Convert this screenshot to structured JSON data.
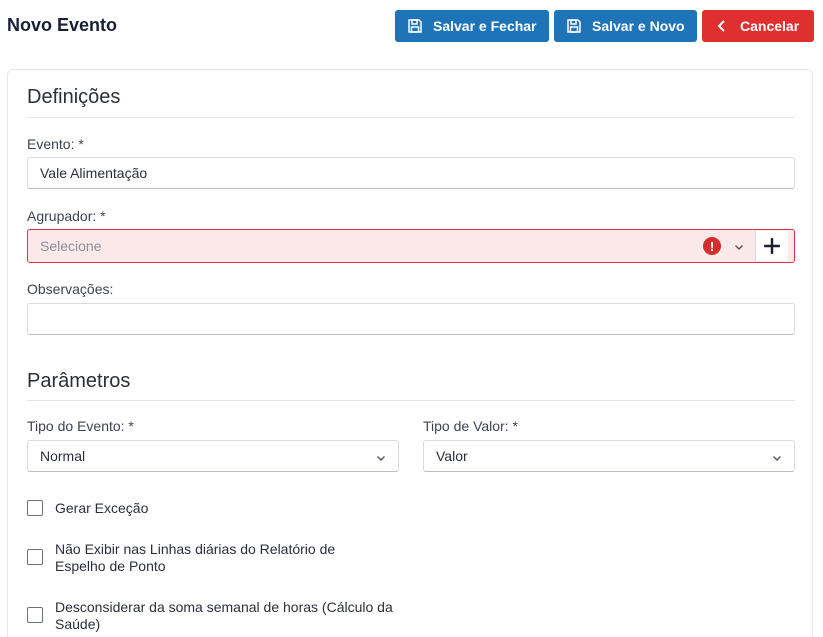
{
  "page_title": "Novo Evento",
  "toolbar": {
    "save_close_label": "Salvar e Fechar",
    "save_new_label": "Salvar e Novo",
    "cancel_label": "Cancelar"
  },
  "definicoes": {
    "title": "Definições",
    "evento_label": "Evento: *",
    "evento_value": "Vale Alimentação",
    "agrupador_label": "Agrupador: *",
    "agrupador_placeholder": "Selecione",
    "observacoes_label": "Observações:",
    "observacoes_value": ""
  },
  "parametros": {
    "title": "Parâmetros",
    "tipo_evento_label": "Tipo do Evento: *",
    "tipo_evento_value": "Normal",
    "tipo_valor_label": "Tipo de Valor: *",
    "tipo_valor_value": "Valor",
    "checkboxes": [
      {
        "label": "Gerar Exceção",
        "checked": false
      },
      {
        "label": "Não Exibir nas Linhas diárias do Relatório de Espelho de Ponto",
        "checked": false
      },
      {
        "label": "Desconsiderar da soma semanal de horas (Cálculo da Saúde)",
        "checked": false
      }
    ]
  },
  "colors": {
    "primary": "#1f74b8",
    "danger": "#e02f2f",
    "error_bg": "#fbe9ea",
    "error_border": "#dc3545"
  },
  "icons": {
    "save": "floppy-disk-icon",
    "cancel": "chevron-left-icon",
    "error": "exclamation-circle-icon",
    "dropdown": "chevron-down-icon",
    "add": "plus-icon"
  }
}
